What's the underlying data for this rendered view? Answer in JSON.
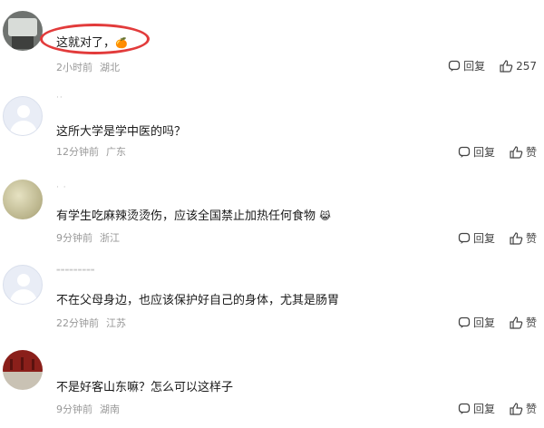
{
  "comments": [
    {
      "username": "",
      "text": "这就对了，",
      "emoji": "🍊",
      "time": "2小时前",
      "location": "湖北",
      "reply": "回复",
      "likes": "257"
    },
    {
      "username": "··",
      "text": "这所大学是学中医的吗？",
      "time": "12分钟前",
      "location": "广东",
      "reply": "回复",
      "likes": "赞"
    },
    {
      "username": "·  ·",
      "text": "有学生吃麻辣烫烫伤，应该全国禁止加热任何食物",
      "emoji": "😹",
      "time": "9分钟前",
      "location": "浙江",
      "reply": "回复",
      "likes": "赞"
    },
    {
      "username": "▬▬▬▬▬▬▬▬▬",
      "text": "不在父母身边，也应该保护好自己的身体，尤其是肠胃",
      "time": "22分钟前",
      "location": "江苏",
      "reply": "回复",
      "likes": "赞"
    },
    {
      "username": "",
      "text": "不是好客山东嘛？怎么可以这样子",
      "time": "9分钟前",
      "location": "湖南",
      "reply": "回复",
      "likes": "赞"
    }
  ]
}
